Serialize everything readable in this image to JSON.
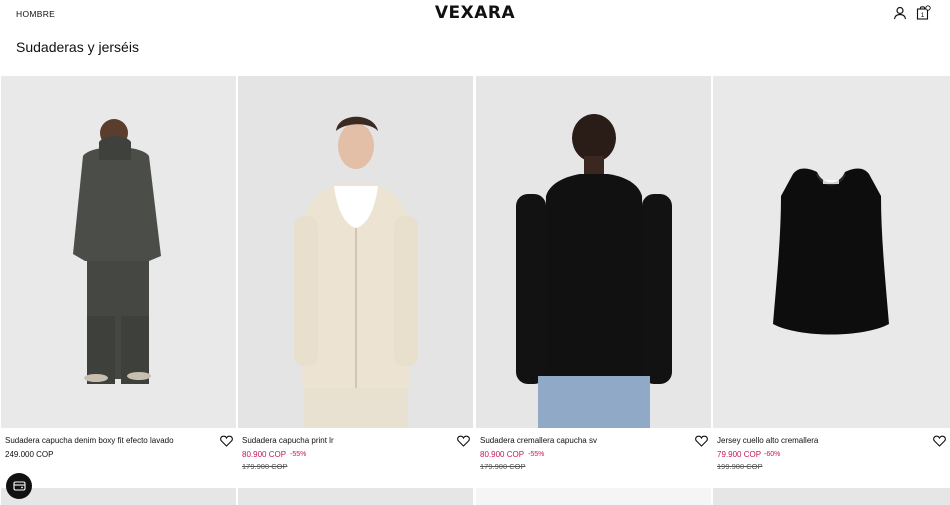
{
  "header": {
    "nav_link": "HOMBRE",
    "brand": "VEXARA",
    "icons": [
      "user-icon",
      "shopping-bag-icon"
    ],
    "bag_count": "1"
  },
  "page_title": "Sudaderas y jerséis",
  "colors": {
    "sale": "#c2185b",
    "text": "#111111",
    "photo_bg": "#e8e8e8"
  },
  "products": [
    {
      "name": "Sudadera capucha denim boxy fit efecto lavado",
      "price": "249.000 COP",
      "discount": "",
      "old_price": "",
      "on_sale": false
    },
    {
      "name": "Sudadera capucha print lr",
      "price": "80.900 COP",
      "discount": "-55%",
      "old_price": "179.900 COP",
      "on_sale": true
    },
    {
      "name": "Sudadera cremallera capucha sv",
      "price": "80.900 COP",
      "discount": "-55%",
      "old_price": "179.900 COP",
      "on_sale": true
    },
    {
      "name": "Jersey cuello alto cremallera",
      "price": "79.900 COP",
      "discount": "-60%",
      "old_price": "199.900 COP",
      "on_sale": true
    }
  ]
}
